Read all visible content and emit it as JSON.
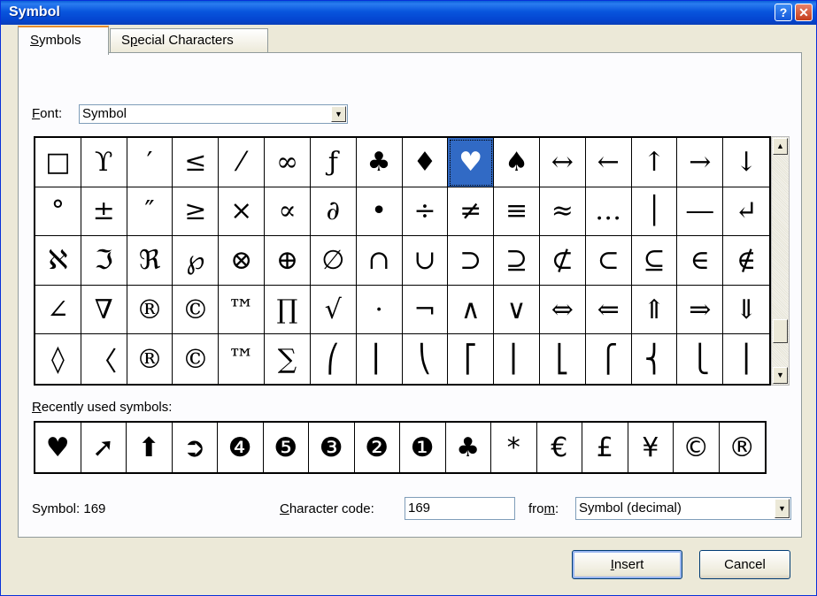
{
  "window": {
    "title": "Symbol",
    "help_label": "?",
    "close_label": "✕"
  },
  "tabs": [
    {
      "label": "Symbols",
      "accel": "S",
      "rest": "ymbols",
      "active": true
    },
    {
      "label": "Special Characters",
      "accel_before": "S",
      "accel": "p",
      "rest": "ecial Characters",
      "active": false
    }
  ],
  "font": {
    "label_accel": "F",
    "label_rest": "ont:",
    "value": "Symbol",
    "arrow": "▼"
  },
  "symbols": [
    [
      "□",
      "ϒ",
      "′",
      "≤",
      "⁄",
      "∞",
      "ƒ",
      "♣",
      "♦",
      "♥",
      "♠",
      "↔",
      "←",
      "↑",
      "→",
      "↓"
    ],
    [
      "°",
      "±",
      "″",
      "≥",
      "×",
      "∝",
      "∂",
      "•",
      "÷",
      "≠",
      "≡",
      "≈",
      "…",
      "│",
      "―",
      "↵"
    ],
    [
      "ℵ",
      "ℑ",
      "ℜ",
      "℘",
      "⊗",
      "⊕",
      "∅",
      "∩",
      "∪",
      "⊃",
      "⊇",
      "⊄",
      "⊂",
      "⊆",
      "∈",
      "∉"
    ],
    [
      "∠",
      "∇",
      "®",
      "©",
      "™",
      "∏",
      "√",
      "⋅",
      "¬",
      "∧",
      "∨",
      "⇔",
      "⇐",
      "⇑",
      "⇒",
      "⇓"
    ],
    [
      "◊",
      "〈",
      "®",
      "©",
      "™",
      "∑",
      "⎛",
      "⎜",
      "⎝",
      "⎡",
      "⎢",
      "⎣",
      "⎧",
      "⎨",
      "⎩",
      "⎪"
    ]
  ],
  "selected_symbol": "♥",
  "scrollbar": {
    "up": "▲",
    "down": "▼"
  },
  "recent": {
    "label_accel": "R",
    "label_rest": "ecently used symbols:",
    "items": [
      "♥",
      "➚",
      "⬆",
      "➲",
      "❹",
      "❺",
      "❸",
      "❷",
      "❶",
      "♣",
      "*",
      "€",
      "£",
      "¥",
      "©",
      "®"
    ]
  },
  "status": {
    "symbol_text": "Symbol: 169",
    "char_code_accel": "C",
    "char_code_rest": "haracter code:",
    "char_code_value": "169",
    "from_before": "fro",
    "from_accel": "m",
    "from_after": ":",
    "from_value": "Symbol (decimal)"
  },
  "buttons": {
    "insert_accel": "I",
    "insert_rest": "nsert",
    "cancel": "Cancel"
  }
}
